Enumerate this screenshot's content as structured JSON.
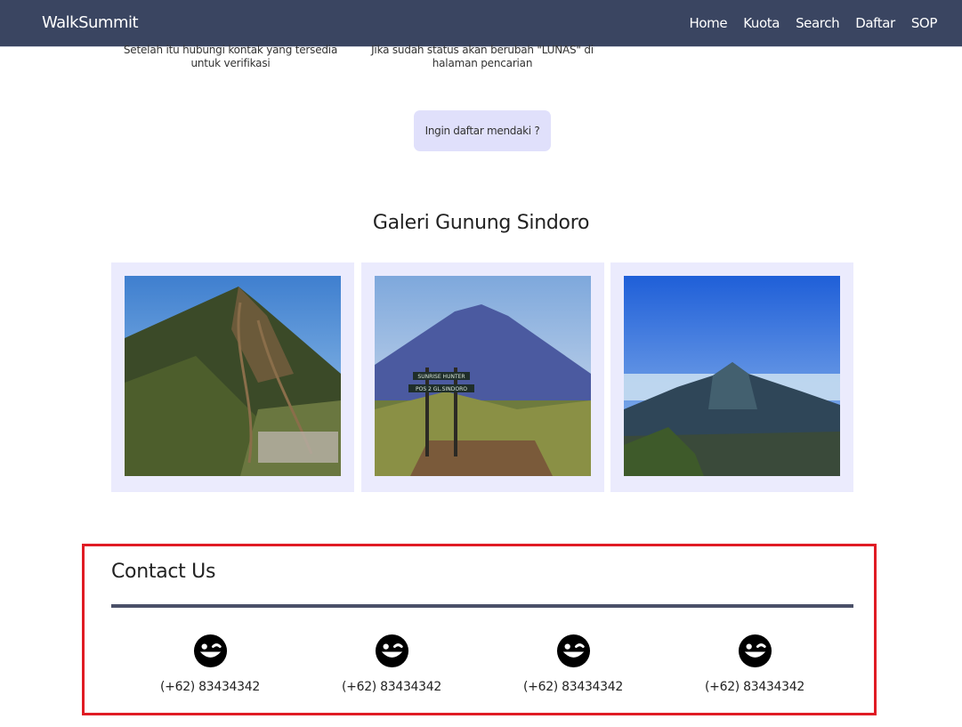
{
  "navbar": {
    "brand": "WalkSummit",
    "links": [
      "Home",
      "Kuota",
      "Search",
      "Daftar",
      "SOP"
    ]
  },
  "steps": [
    {
      "text": "Setelah itu hubungi kontak yang tersedia untuk verifikasi"
    },
    {
      "text": "Jika sudah status akan berubah \"LUNAS\" di halaman pencarian"
    }
  ],
  "cta": {
    "label": "Ingin daftar mendaki ?"
  },
  "gallery": {
    "title": "Galeri Gunung Sindoro",
    "signpost_lines": [
      "SUNRISE HUNTER",
      "POS 2 GL.SINDORO"
    ]
  },
  "contact": {
    "title": "Contact Us",
    "items": [
      {
        "icon": "wink-smile-icon",
        "phone": "(+62) 83434342"
      },
      {
        "icon": "wink-smile-icon",
        "phone": "(+62) 83434342"
      },
      {
        "icon": "wink-smile-icon",
        "phone": "(+62) 83434342"
      },
      {
        "icon": "wink-smile-icon",
        "phone": "(+62) 83434342"
      }
    ]
  },
  "colors": {
    "navbar": "#3a4561",
    "accent_button": "#e0e0fb",
    "card_bg": "#ebebfd",
    "highlight": "#e01b24"
  }
}
